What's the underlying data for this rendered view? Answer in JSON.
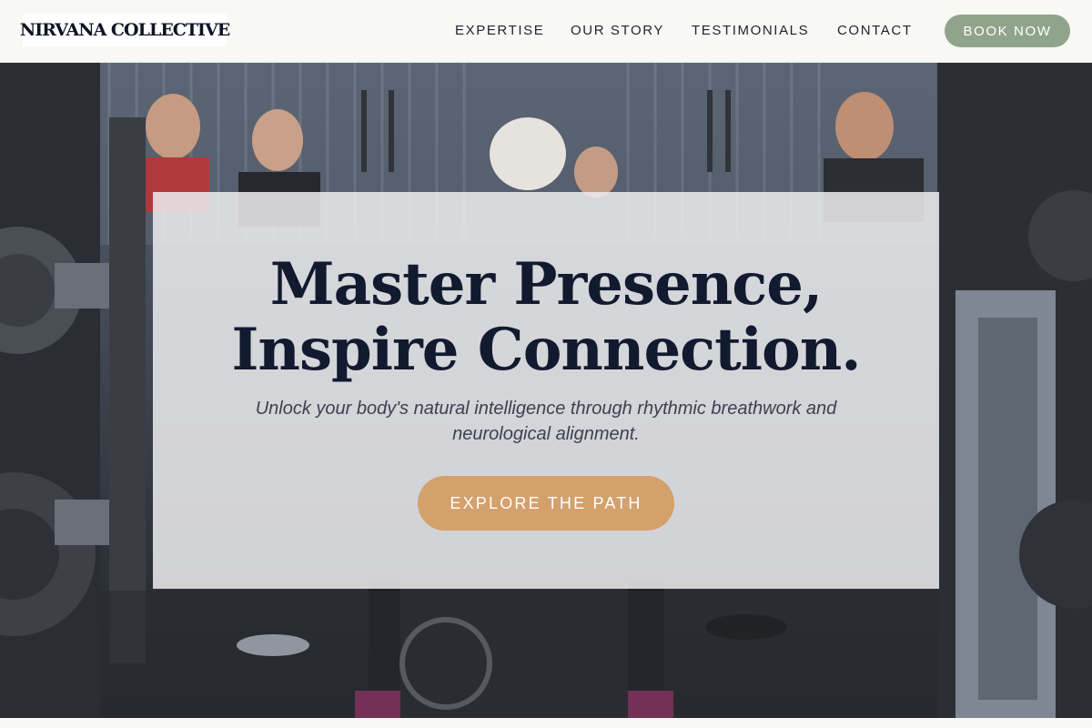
{
  "brand": {
    "logo_text": "NIRVANA COLLECTIVE"
  },
  "nav": {
    "items": [
      {
        "label": "EXPERTISE"
      },
      {
        "label": "OUR STORY"
      },
      {
        "label": "TESTIMONIALS"
      },
      {
        "label": "CONTACT"
      }
    ],
    "cta_label": "BOOK NOW"
  },
  "hero": {
    "headline_line1": "Master Presence,",
    "headline_line2": "Inspire Connection.",
    "subtitle": "Unlock your body's natural intelligence through rhythmic breathwork and neurological alignment.",
    "cta_label": "EXPLORE THE PATH",
    "background_image": "gym-weightlifting-photo"
  },
  "colors": {
    "header_background": "#f8f8f4",
    "book_button": "#8fa48a",
    "cta_button": "#d4a06c",
    "headline": "#121a30",
    "subtitle": "#3b4150",
    "card_overlay": "#eeeef0"
  }
}
